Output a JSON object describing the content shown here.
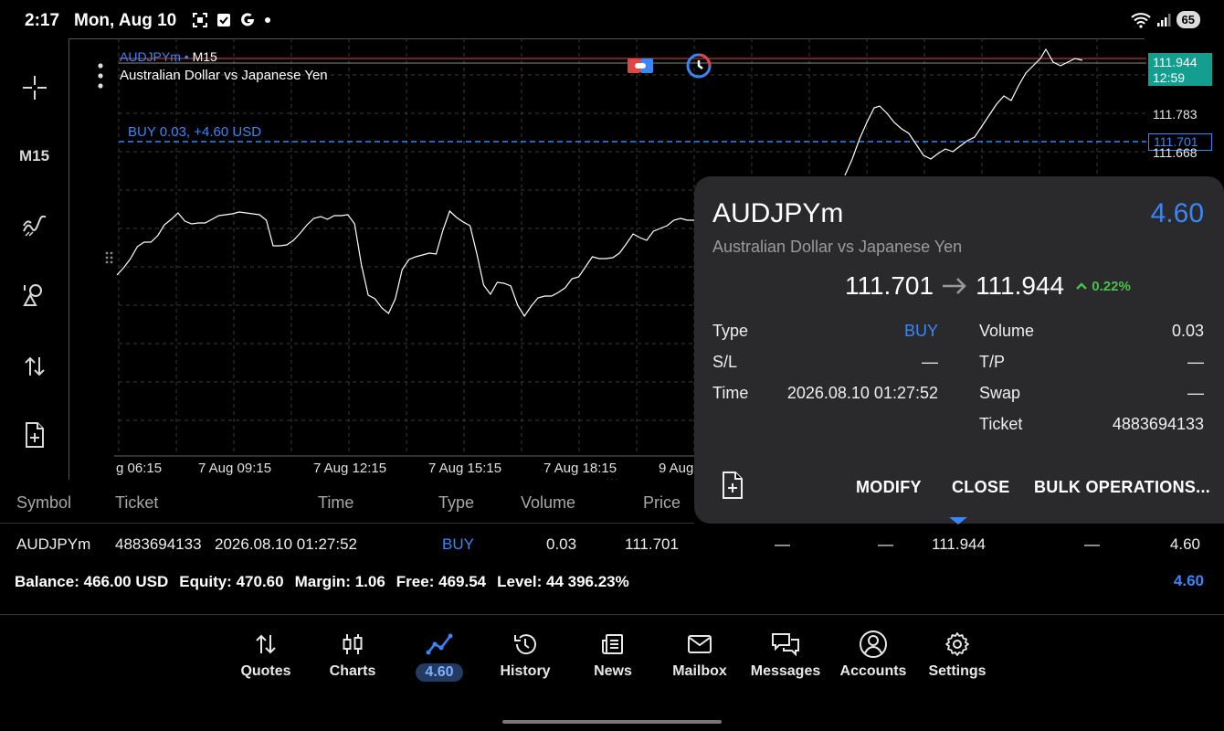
{
  "status_bar": {
    "time": "2:17",
    "date": "Mon, Aug 10",
    "battery": "65"
  },
  "toolbar": {
    "timeframe": "M15"
  },
  "chart": {
    "symbol": "AUDJPYm",
    "dot": "•",
    "timeframe": "M15",
    "description": "Australian Dollar vs Japanese Yen",
    "buy_line_label": "BUY 0.03,   +4.60 USD",
    "price_current": "111.944",
    "countdown": "12:59",
    "price_level_1": "111.783",
    "price_buy": "111.701",
    "price_level_2": "111.668",
    "time_labels": [
      "g 06:15",
      "7 Aug 09:15",
      "7 Aug 12:15",
      "7 Aug 15:15",
      "7 Aug 18:15",
      "9 Aug"
    ]
  },
  "popup": {
    "symbol": "AUDJPYm",
    "profit": "4.60",
    "description": "Australian Dollar vs Japanese Yen",
    "open_price": "111.701",
    "current_price": "111.944",
    "change": "0.22%",
    "type_label": "Type",
    "type_value": "BUY",
    "sl_label": "S/L",
    "sl_value": "—",
    "time_label": "Time",
    "time_value": "2026.08.10 01:27:52",
    "volume_label": "Volume",
    "volume_value": "0.03",
    "tp_label": "T/P",
    "tp_value": "—",
    "swap_label": "Swap",
    "swap_value": "—",
    "ticket_label": "Ticket",
    "ticket_value": "4883694133",
    "modify_label": "MODIFY",
    "close_label": "CLOSE",
    "bulk_label": "BULK OPERATIONS..."
  },
  "table": {
    "headers": {
      "symbol": "Symbol",
      "ticket": "Ticket",
      "time": "Time",
      "type": "Type",
      "volume": "Volume",
      "price": "Price"
    },
    "row": {
      "symbol": "AUDJPYm",
      "ticket": "4883694133",
      "time": "2026.08.10 01:27:52",
      "type": "BUY",
      "volume": "0.03",
      "price": "111.701",
      "sl": "—",
      "tp": "—",
      "current": "111.944",
      "swap": "—",
      "profit": "4.60"
    }
  },
  "account": {
    "balance_label": "Balance:",
    "balance_value": "466.00 USD",
    "equity_label": "Equity:",
    "equity_value": "470.60",
    "margin_label": "Margin:",
    "margin_value": "1.06",
    "free_label": "Free:",
    "free_value": "469.54",
    "level_label": "Level:",
    "level_value": "44 396.23%",
    "total_profit": "4.60"
  },
  "nav": {
    "quotes": "Quotes",
    "charts": "Charts",
    "trade": "4.60",
    "history": "History",
    "news": "News",
    "mailbox": "Mailbox",
    "messages": "Messages",
    "accounts": "Accounts",
    "settings": "Settings"
  },
  "colors": {
    "accent": "#3b86f7",
    "positive": "#47c04a",
    "price_tag": "#149e8f",
    "background": "#000000",
    "popup": "#2a2a2d"
  },
  "chart_price_path": [
    301,
    293,
    283,
    270,
    265,
    265,
    258,
    246,
    240,
    233,
    242,
    245,
    244,
    244,
    240,
    236,
    235,
    234,
    232,
    233,
    234,
    235,
    241,
    269,
    269,
    268,
    263,
    255,
    246,
    239,
    237,
    240,
    236,
    236,
    235,
    245,
    290,
    323,
    327,
    337,
    343,
    327,
    295,
    284,
    281,
    279,
    277,
    278,
    252,
    231,
    238,
    243,
    247,
    278,
    312,
    322,
    309,
    310,
    313,
    334,
    346,
    335,
    326,
    324,
    324,
    320,
    315,
    305,
    303,
    292,
    281,
    283,
    283,
    282,
    277,
    267,
    256,
    260,
    263,
    253,
    250,
    247,
    241,
    239,
    241,
    241
  ]
}
